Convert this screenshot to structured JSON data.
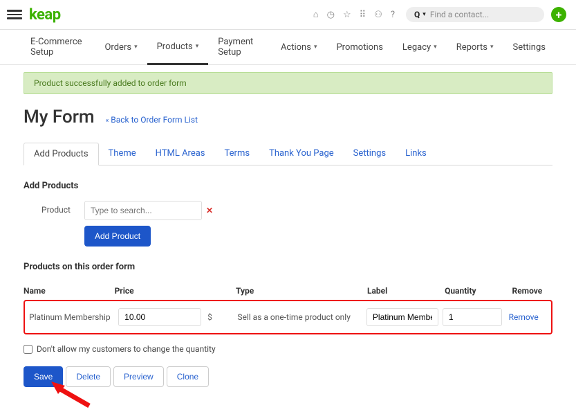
{
  "top": {
    "logo": "keap",
    "search_placeholder": "Find a contact..."
  },
  "mainnav": {
    "items": [
      {
        "label": "E-Commerce Setup",
        "chev": false
      },
      {
        "label": "Orders",
        "chev": true
      },
      {
        "label": "Products",
        "chev": true,
        "active": true
      },
      {
        "label": "Payment Setup",
        "chev": false
      },
      {
        "label": "Actions",
        "chev": true
      },
      {
        "label": "Promotions",
        "chev": false
      },
      {
        "label": "Legacy",
        "chev": true
      },
      {
        "label": "Reports",
        "chev": true
      },
      {
        "label": "Settings",
        "chev": false
      }
    ]
  },
  "alert": "Product successfully added to order form",
  "page_title": "My Form",
  "back_link": "Back to Order Form List",
  "subnav": [
    {
      "label": "Add Products",
      "active": true
    },
    {
      "label": "Theme"
    },
    {
      "label": "HTML Areas"
    },
    {
      "label": "Terms"
    },
    {
      "label": "Thank You Page"
    },
    {
      "label": "Settings"
    },
    {
      "label": "Links"
    }
  ],
  "add_products": {
    "heading": "Add Products",
    "field_label": "Product",
    "placeholder": "Type to search...",
    "button": "Add Product"
  },
  "products_section": {
    "heading": "Products on this order form",
    "columns": {
      "name": "Name",
      "price": "Price",
      "type": "Type",
      "label": "Label",
      "qty": "Quantity",
      "remove": "Remove"
    },
    "row": {
      "name": "Platinum Membership",
      "price": "10.00",
      "currency": "$",
      "type": "Sell as a one-time product only",
      "label": "Platinum Membership",
      "qty": "1",
      "remove": "Remove"
    },
    "lock_qty": "Don't allow my customers to change the quantity"
  },
  "actions": {
    "save": "Save",
    "delete": "Delete",
    "preview": "Preview",
    "clone": "Clone"
  }
}
